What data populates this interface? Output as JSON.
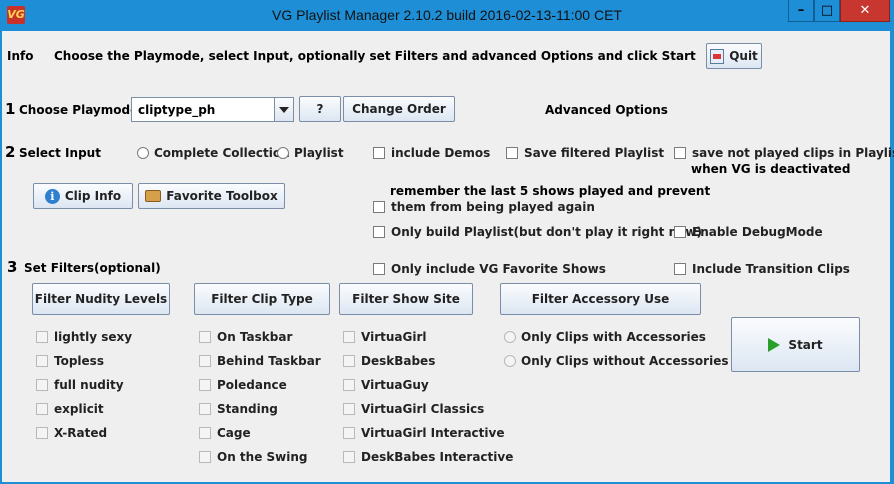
{
  "window": {
    "title": "VG Playlist Manager 2.10.2 build 2016-02-13-11:00 CET",
    "icon": "vg-logo-icon",
    "controls": {
      "minimize": "–",
      "maximize": "□",
      "close": "✕"
    }
  },
  "info": {
    "label": "Info",
    "message": "Choose the Playmode, select Input, optionally set Filters and advanced Options and click Start",
    "quit_label": "Quit"
  },
  "playmode": {
    "step": "1",
    "label": "Choose Playmode",
    "selected": "cliptype_ph",
    "help_label": "?",
    "change_order_label": "Change Order",
    "advanced_label": "Advanced Options"
  },
  "input": {
    "step": "2",
    "label": "Select Input",
    "complete_collection": "Complete Collection",
    "playlist": "Playlist",
    "clip_info": "Clip Info",
    "favorite_toolbox": "Favorite Toolbox"
  },
  "advanced": {
    "include_demos": "include Demos",
    "save_filtered": "Save filtered Playlist",
    "save_not_played_1": "save not played clips in Playlist",
    "save_not_played_2": "when VG is deactivated",
    "remember_1": "remember the last 5 shows played and prevent",
    "remember_2": "them from being played again",
    "only_build": "Only build Playlist(but don't play it right now)",
    "debug": "Enable DebugMode",
    "only_favorites": "Only include VG Favorite Shows",
    "transition": "Include Transition Clips"
  },
  "filters": {
    "step": "3",
    "label": "Set Filters(optional)",
    "nudity_button": "Filter Nudity Levels",
    "cliptype_button": "Filter Clip Type",
    "site_button": "Filter Show Site",
    "accessory_button": "Filter Accessory Use",
    "nudity": [
      "lightly sexy",
      "Topless",
      "full nudity",
      "explicit",
      "X-Rated"
    ],
    "cliptype": [
      "On Taskbar",
      "Behind Taskbar",
      "Poledance",
      "Standing",
      "Cage",
      "On the Swing"
    ],
    "site": [
      "VirtuaGirl",
      "DeskBabes",
      "VirtuaGuy",
      "VirtuaGirl Classics",
      "VirtuaGirl Interactive",
      "DeskBabes Interactive"
    ],
    "accessory": [
      "Only Clips with Accessories",
      "Only Clips without Accessories"
    ]
  },
  "start_label": "Start"
}
